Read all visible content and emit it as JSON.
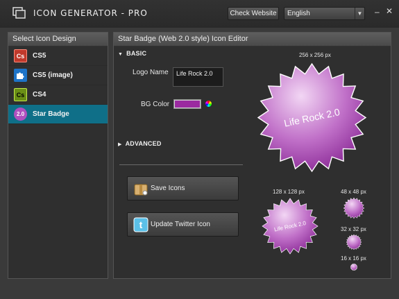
{
  "window": {
    "title": "ICON GENERATOR - PRO",
    "check_website": "Check Website",
    "language": "English",
    "minimize": "–",
    "close": "✕"
  },
  "left_panel": {
    "header": "Select Icon Design",
    "items": [
      {
        "label": "CS5",
        "icon": "cs5-icon",
        "icon_text": "Cs",
        "color": "#c0392b"
      },
      {
        "label": "CS5 (image)",
        "icon": "puzzle-icon",
        "icon_text": "",
        "color": "#1e74c8"
      },
      {
        "label": "CS4",
        "icon": "cs4-icon",
        "icon_text": "Cs",
        "color": "#8fb92a"
      },
      {
        "label": "Star Badge",
        "icon": "star-badge-icon",
        "icon_text": "2.0",
        "color": "#a040b0",
        "selected": true
      }
    ]
  },
  "editor": {
    "header": "Star Badge (Web 2.0 style) Icon Editor",
    "basic_label": "BASIC",
    "logo_name_label": "Logo Name",
    "logo_name_value": "Life Rock 2.0",
    "bg_color_label": "BG Color",
    "bg_color": "#9b2aa0",
    "advanced_label": "ADVANCED",
    "save_button": "Save Icons",
    "twitter_button": "Update Twitter Icon"
  },
  "previews": {
    "size_256": "256 x 256 px",
    "size_128": "128 x 128 px",
    "size_48": "48 x 48 px",
    "size_32": "32 x 32 px",
    "size_16": "16 x 16 px",
    "badge_text": "Life Rock 2.0",
    "badge_color": "#c070c8"
  }
}
